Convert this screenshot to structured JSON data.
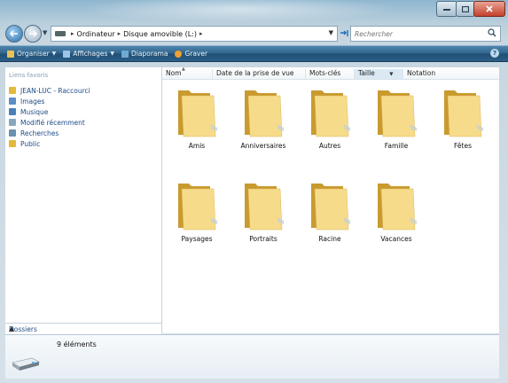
{
  "window": {
    "title": "",
    "controls": {
      "minimize": "minimize",
      "maximize": "maximize",
      "close": "close"
    }
  },
  "address": {
    "crumbs": [
      "Ordinateur",
      "Disque amovible (L:)"
    ],
    "search_placeholder": "Rechercher"
  },
  "toolbar": {
    "items": [
      {
        "label": "Organiser",
        "icon": "organize-icon",
        "color": "#e8c35a"
      },
      {
        "label": "Affichages",
        "icon": "views-icon",
        "color": "#9cc4e4"
      },
      {
        "label": "Diaporama",
        "icon": "slideshow-icon",
        "color": "#6fa9d6"
      },
      {
        "label": "Graver",
        "icon": "burn-icon",
        "color": "#f0a030"
      }
    ],
    "help_label": "?"
  },
  "navpane": {
    "heading": "Liens favoris",
    "items": [
      {
        "label": "JEAN-LUC - Raccourci",
        "icon": "folder-icon",
        "color": "#e2b93b"
      },
      {
        "label": "Images",
        "icon": "pictures-icon",
        "color": "#5b8fc6"
      },
      {
        "label": "Musique",
        "icon": "music-icon",
        "color": "#4b7fb7"
      },
      {
        "label": "Modifié récemment",
        "icon": "recent-icon",
        "color": "#8aa6bd"
      },
      {
        "label": "Recherches",
        "icon": "search-folder-icon",
        "color": "#6b8fae"
      },
      {
        "label": "Public",
        "icon": "folder-icon",
        "color": "#e2b93b"
      }
    ],
    "folders_label": "Dossiers"
  },
  "columns": [
    "Nom",
    "Date de la prise de vue",
    "Mots-clés",
    "Taille",
    "Notation"
  ],
  "files": [
    {
      "label": "Amis",
      "photo": false
    },
    {
      "label": "Anniversaires",
      "photo": false
    },
    {
      "label": "Autres",
      "photo": true
    },
    {
      "label": "Famille",
      "photo": false
    },
    {
      "label": "Fêtes",
      "photo": false
    },
    {
      "label": "Paysages",
      "photo": false
    },
    {
      "label": "Portraits",
      "photo": false
    },
    {
      "label": "Racine",
      "photo": false
    },
    {
      "label": "Vacances",
      "photo": false
    }
  ],
  "details": {
    "count": "9 éléments"
  }
}
